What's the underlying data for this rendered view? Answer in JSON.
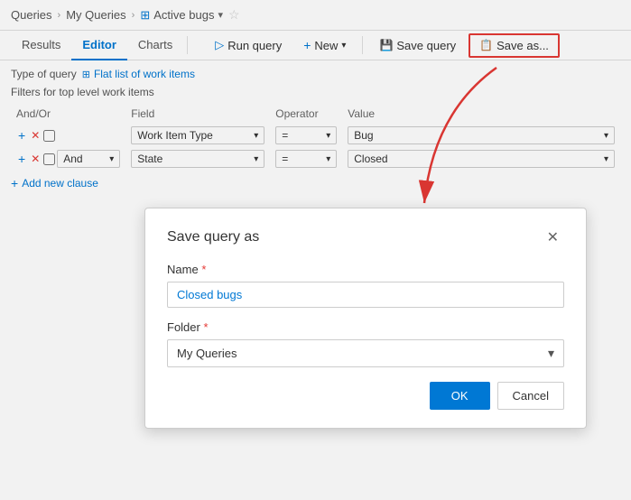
{
  "breadcrumb": {
    "queries": "Queries",
    "myQueries": "My Queries",
    "activeBugs": "Active bugs",
    "sep": "›"
  },
  "tabs": {
    "results": "Results",
    "editor": "Editor",
    "charts": "Charts",
    "active": "editor"
  },
  "toolbar": {
    "runQuery": "Run query",
    "new": "New",
    "saveQuery": "Save query",
    "saveAs": "Save as..."
  },
  "queryArea": {
    "typeLabel": "Type of query",
    "flatList": "Flat list of work items",
    "filtersLabel": "Filters for top level work items",
    "andOrHeader": "And/Or",
    "fieldHeader": "Field",
    "operatorHeader": "Operator",
    "valueHeader": "Value",
    "addClause": "Add new clause",
    "row1": {
      "field": "Work Item Type",
      "operator": "=",
      "value": "Bug"
    },
    "row2": {
      "andOr": "And",
      "field": "State",
      "operator": "=",
      "value": "Closed"
    }
  },
  "modal": {
    "title": "Save query as",
    "nameLabel": "Name",
    "nameValue": "Closed bugs",
    "folderLabel": "Folder",
    "folderValue": "My Queries",
    "okLabel": "OK",
    "cancelLabel": "Cancel",
    "required": "*"
  }
}
